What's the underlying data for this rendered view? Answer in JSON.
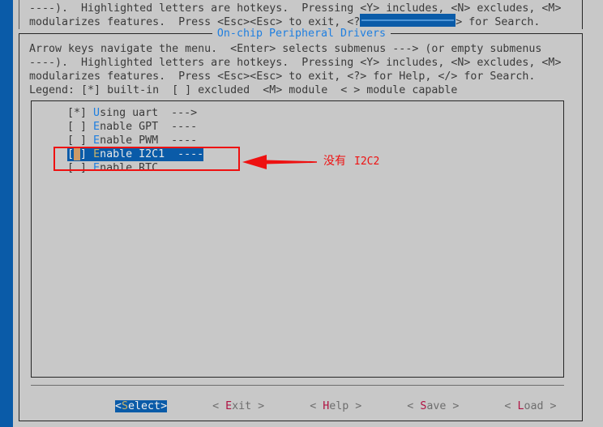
{
  "colors": {
    "background": "#c8c8c8",
    "left_strip": "#0a5ba8",
    "highlight_bg": "#0a5ba8",
    "hotkey_blue": "#1f7fe0",
    "hotkey_selected": "#c8b36a",
    "hotkey_button": "#b01242",
    "cursor_block": "#cc9966",
    "annotation_red": "#ee1111",
    "text": "#3a3a3a",
    "border": "#262626"
  },
  "background_menu": {
    "line1": "----).  Highlighted letters are hotkeys.  Pressing <Y> includes, <N> excludes, <M>",
    "line2_before": "modularizes features.  Press <Esc><Esc> to exit, <?",
    "line2_after": "> for Search.",
    "search_field_value": ""
  },
  "dialog": {
    "title": "On-chip Peripheral Drivers",
    "help_lines": [
      "Arrow keys navigate the menu.  <Enter> selects submenus ---> (or empty submenus",
      "----).  Highlighted letters are hotkeys.  Pressing <Y> includes, <N> excludes, <M>",
      "modularizes features.  Press <Esc><Esc> to exit, <?> for Help, </> for Search.",
      "Legend: [*] built-in  [ ] excluded  <M> module  < > module capable"
    ]
  },
  "menu": {
    "items": [
      {
        "checkbox": "[*]",
        "hotkey": "U",
        "label_rest": "sing uart",
        "suffix": "  --->",
        "selected": false,
        "state": "built-in"
      },
      {
        "checkbox": "[ ]",
        "hotkey": "E",
        "label_rest": "nable GPT",
        "suffix": "  ----",
        "selected": false,
        "state": "excluded"
      },
      {
        "checkbox": "[ ]",
        "hotkey": "E",
        "label_rest": "nable PWM",
        "suffix": "  ----",
        "selected": false,
        "state": "excluded"
      },
      {
        "checkbox_open": "[",
        "checkbox_cursor": " ",
        "checkbox_close": "]",
        "hotkey": "E",
        "label_rest": "nable I2C1",
        "suffix": "  ----",
        "selected": true,
        "state": "excluded"
      },
      {
        "checkbox": "[ ]",
        "hotkey": "E",
        "label_rest": "nable RTC",
        "suffix": "",
        "selected": false,
        "state": "excluded"
      }
    ]
  },
  "buttons": [
    {
      "open": "<",
      "hotkey": "S",
      "rest": "elect",
      "close": ">",
      "selected": true
    },
    {
      "open": "<",
      "hotkey": "E",
      "rest": "xit",
      "close": ">",
      "selected": false
    },
    {
      "open": "<",
      "hotkey": "H",
      "rest": "elp",
      "close": ">",
      "selected": false
    },
    {
      "open": "<",
      "hotkey": "S",
      "rest": "ave",
      "close": ">",
      "selected": false
    },
    {
      "open": "<",
      "hotkey": "L",
      "rest": "oad",
      "close": ">",
      "selected": false
    }
  ],
  "annotation": {
    "text_cn": "没有",
    "text_code": "I2C2"
  }
}
